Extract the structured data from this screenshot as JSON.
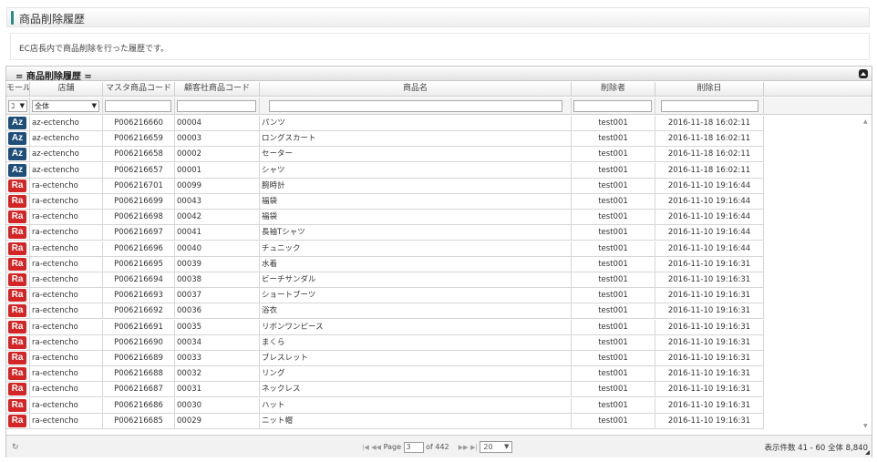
{
  "page": {
    "title": "商品削除履歴",
    "description": "EC店長内で商品削除を行った履歴です。"
  },
  "grid": {
    "title": "= 商品削除履歴 =",
    "columns": [
      "モール",
      "店舗",
      "マスタ商品コード",
      "顧客社商品コード",
      "商品名",
      "削除者",
      "削除日"
    ],
    "filters": {
      "mall_value": "ｺ",
      "store_value": "全体"
    },
    "rows": [
      {
        "mall": "Az",
        "store": "az-ectencho",
        "master_code": "P006216660",
        "customer_code": "00004",
        "name": "パンツ",
        "deleted_by": "test001",
        "deleted_at": "2016-11-18 16:02:11"
      },
      {
        "mall": "Az",
        "store": "az-ectencho",
        "master_code": "P006216659",
        "customer_code": "00003",
        "name": "ロングスカート",
        "deleted_by": "test001",
        "deleted_at": "2016-11-18 16:02:11"
      },
      {
        "mall": "Az",
        "store": "az-ectencho",
        "master_code": "P006216658",
        "customer_code": "00002",
        "name": "セーター",
        "deleted_by": "test001",
        "deleted_at": "2016-11-18 16:02:11"
      },
      {
        "mall": "Az",
        "store": "az-ectencho",
        "master_code": "P006216657",
        "customer_code": "00001",
        "name": "シャツ",
        "deleted_by": "test001",
        "deleted_at": "2016-11-18 16:02:11"
      },
      {
        "mall": "Ra",
        "store": "ra-ectencho",
        "master_code": "P006216701",
        "customer_code": "00099",
        "name": "腕時計",
        "deleted_by": "test001",
        "deleted_at": "2016-11-10 19:16:44"
      },
      {
        "mall": "Ra",
        "store": "ra-ectencho",
        "master_code": "P006216699",
        "customer_code": "00043",
        "name": "福袋",
        "deleted_by": "test001",
        "deleted_at": "2016-11-10 19:16:44"
      },
      {
        "mall": "Ra",
        "store": "ra-ectencho",
        "master_code": "P006216698",
        "customer_code": "00042",
        "name": "福袋",
        "deleted_by": "test001",
        "deleted_at": "2016-11-10 19:16:44"
      },
      {
        "mall": "Ra",
        "store": "ra-ectencho",
        "master_code": "P006216697",
        "customer_code": "00041",
        "name": "長袖Tシャツ",
        "deleted_by": "test001",
        "deleted_at": "2016-11-10 19:16:44"
      },
      {
        "mall": "Ra",
        "store": "ra-ectencho",
        "master_code": "P006216696",
        "customer_code": "00040",
        "name": "チュニック",
        "deleted_by": "test001",
        "deleted_at": "2016-11-10 19:16:44"
      },
      {
        "mall": "Ra",
        "store": "ra-ectencho",
        "master_code": "P006216695",
        "customer_code": "00039",
        "name": "水着",
        "deleted_by": "test001",
        "deleted_at": "2016-11-10 19:16:31"
      },
      {
        "mall": "Ra",
        "store": "ra-ectencho",
        "master_code": "P006216694",
        "customer_code": "00038",
        "name": "ビーチサンダル",
        "deleted_by": "test001",
        "deleted_at": "2016-11-10 19:16:31"
      },
      {
        "mall": "Ra",
        "store": "ra-ectencho",
        "master_code": "P006216693",
        "customer_code": "00037",
        "name": "ショートブーツ",
        "deleted_by": "test001",
        "deleted_at": "2016-11-10 19:16:31"
      },
      {
        "mall": "Ra",
        "store": "ra-ectencho",
        "master_code": "P006216692",
        "customer_code": "00036",
        "name": "浴衣",
        "deleted_by": "test001",
        "deleted_at": "2016-11-10 19:16:31"
      },
      {
        "mall": "Ra",
        "store": "ra-ectencho",
        "master_code": "P006216691",
        "customer_code": "00035",
        "name": "リボンワンピース",
        "deleted_by": "test001",
        "deleted_at": "2016-11-10 19:16:31"
      },
      {
        "mall": "Ra",
        "store": "ra-ectencho",
        "master_code": "P006216690",
        "customer_code": "00034",
        "name": "まくら",
        "deleted_by": "test001",
        "deleted_at": "2016-11-10 19:16:31"
      },
      {
        "mall": "Ra",
        "store": "ra-ectencho",
        "master_code": "P006216689",
        "customer_code": "00033",
        "name": "ブレスレット",
        "deleted_by": "test001",
        "deleted_at": "2016-11-10 19:16:31"
      },
      {
        "mall": "Ra",
        "store": "ra-ectencho",
        "master_code": "P006216688",
        "customer_code": "00032",
        "name": "リング",
        "deleted_by": "test001",
        "deleted_at": "2016-11-10 19:16:31"
      },
      {
        "mall": "Ra",
        "store": "ra-ectencho",
        "master_code": "P006216687",
        "customer_code": "00031",
        "name": "ネックレス",
        "deleted_by": "test001",
        "deleted_at": "2016-11-10 19:16:31"
      },
      {
        "mall": "Ra",
        "store": "ra-ectencho",
        "master_code": "P006216686",
        "customer_code": "00030",
        "name": "ハット",
        "deleted_by": "test001",
        "deleted_at": "2016-11-10 19:16:31"
      },
      {
        "mall": "Ra",
        "store": "ra-ectencho",
        "master_code": "P006216685",
        "customer_code": "00029",
        "name": "ニット帽",
        "deleted_by": "test001",
        "deleted_at": "2016-11-10 19:16:31"
      }
    ],
    "mall_colors": {
      "Az": "#1f4e79",
      "Ra": "#d32525"
    }
  },
  "pager": {
    "first": "|◀",
    "prev": "◀◀",
    "page_label": "Page",
    "current_page": "3",
    "of_label": "of 442",
    "next": "▶▶",
    "last": "▶|",
    "page_size": "20",
    "record_info": "表示件数 41 - 60 全体 8,840"
  },
  "icons": {
    "refresh": "↻",
    "dropdown": "▼",
    "scroll_up": "▲",
    "scroll_down": "▼"
  }
}
